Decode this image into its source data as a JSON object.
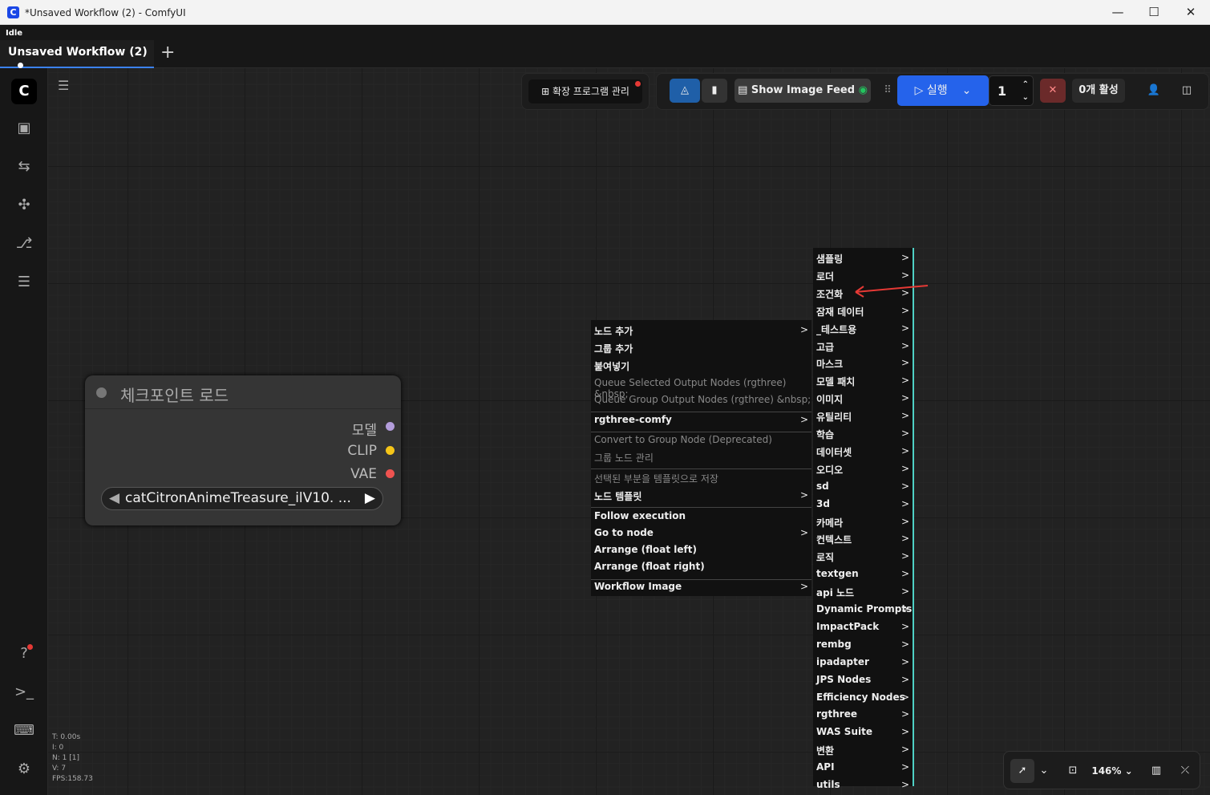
{
  "window": {
    "title": "*Unsaved Workflow (2) - ComfyUI",
    "minimize": "—",
    "maximize": "☐",
    "close": "✕"
  },
  "status": "Idle",
  "tab": {
    "label": "Unsaved Workflow (2)",
    "add": "+"
  },
  "toolbar": {
    "extensions": "확장 프로그램 관리",
    "image_feed": "Show Image Feed",
    "run": "실행",
    "batch": "1",
    "active": "0개 활성"
  },
  "node": {
    "title": "체크포인트 로드",
    "outputs": [
      "모델",
      "CLIP",
      "VAE"
    ],
    "ckpt": "catCitronAnimeTreasure_ilV10. ...",
    "colors": {
      "model": "#b39ddb",
      "clip": "#f5c518",
      "vae": "#ef5350"
    }
  },
  "context_menu": [
    {
      "label": "노드 추가",
      "sub": true,
      "disabled": false
    },
    {
      "label": "그룹 추가",
      "sub": false,
      "disabled": false
    },
    {
      "label": "붙여넣기",
      "sub": false,
      "disabled": false
    },
    {
      "label": "Queue Selected Output Nodes (rgthree) &nbsp;",
      "sub": false,
      "disabled": true
    },
    {
      "label": "Queue Group Output Nodes (rgthree) &nbsp;",
      "sub": false,
      "disabled": true
    },
    {
      "label": "rgthree-comfy",
      "sub": true,
      "disabled": false
    },
    {
      "label": "Convert to Group Node (Deprecated)",
      "sub": false,
      "disabled": true
    },
    {
      "label": "그룹 노드 관리",
      "sub": false,
      "disabled": true
    },
    {
      "label": "선택된 부분을 템플릿으로 저장",
      "sub": false,
      "disabled": true
    },
    {
      "label": "노드 템플릿",
      "sub": true,
      "disabled": false
    },
    {
      "label": "Follow execution",
      "sub": false,
      "disabled": false
    },
    {
      "label": "Go to node",
      "sub": true,
      "disabled": false
    },
    {
      "label": "Arrange (float left)",
      "sub": false,
      "disabled": false
    },
    {
      "label": "Arrange (float right)",
      "sub": false,
      "disabled": false
    },
    {
      "label": "Workflow Image",
      "sub": true,
      "disabled": false
    }
  ],
  "submenu": [
    "샘플링",
    "로더",
    "조건화",
    "잠재 데이터",
    "_테스트용",
    "고급",
    "마스크",
    "모델 패치",
    "이미지",
    "유틸리티",
    "학습",
    "데이터셋",
    "오디오",
    "sd",
    "3d",
    "카메라",
    "컨텍스트",
    "로직",
    "textgen",
    "api 노드",
    "Dynamic Prompts",
    "ImpactPack",
    "rembg",
    "ipadapter",
    "JPS Nodes",
    "Efficiency Nodes",
    "rgthree",
    "WAS Suite",
    "변환",
    "API",
    "utils"
  ],
  "stats": [
    "T: 0.00s",
    "I: 0",
    "N: 1 [1]",
    "V: 7",
    "FPS:158.73"
  ],
  "zoom": "146%",
  "colors": {
    "accent": "#3b82f6",
    "teal": "#4fd1c5",
    "annotation": "#e53935"
  }
}
